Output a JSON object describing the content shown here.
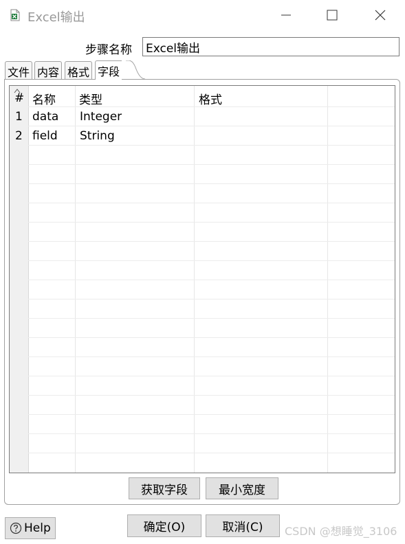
{
  "window": {
    "title": "Excel输出",
    "icon": "excel-file-icon",
    "controls": [
      "minimize-icon",
      "maximize-icon",
      "close-icon"
    ]
  },
  "step": {
    "label": "步骤名称",
    "value": "Excel输出"
  },
  "tabs": [
    {
      "label": "文件",
      "active": false
    },
    {
      "label": "内容",
      "active": false
    },
    {
      "label": "格式",
      "active": false
    },
    {
      "label": "字段",
      "active": true
    }
  ],
  "table": {
    "headers": [
      "#",
      "名称",
      "类型",
      "格式"
    ],
    "rows": [
      {
        "num": "1",
        "name": "data",
        "type": "Integer",
        "format": ""
      },
      {
        "num": "2",
        "name": "field",
        "type": "String",
        "format": ""
      }
    ]
  },
  "panel_buttons": {
    "get_fields": "获取字段",
    "min_width": "最小宽度"
  },
  "footer": {
    "help": "Help",
    "ok": "确定(O)",
    "cancel": "取消(C)"
  },
  "watermark": "CSDN @想睡觉_3106"
}
